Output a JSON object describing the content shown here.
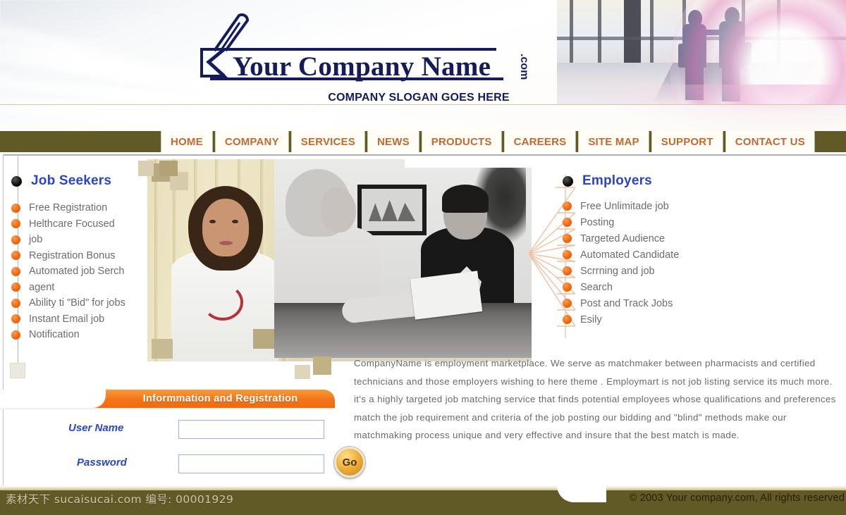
{
  "header": {
    "logo_title": "Your Company Name",
    "logo_dotcom": ".com",
    "slogan": "COMPANY SLOGAN GOES HERE",
    "banner_image_alt": "business-handshake-photo"
  },
  "nav": {
    "items": [
      {
        "label": "HOME"
      },
      {
        "label": "COMPANY"
      },
      {
        "label": "SERVICES"
      },
      {
        "label": "NEWS"
      },
      {
        "label": "PRODUCTS"
      },
      {
        "label": "CAREERS"
      },
      {
        "label": "SITE MAP"
      },
      {
        "label": "SUPPORT"
      },
      {
        "label": "CONTACT US"
      }
    ]
  },
  "job_seekers": {
    "title": "Job Seekers",
    "items": [
      "Free Registration",
      "Helthcare Focused",
      "job",
      "Registration  Bonus",
      "Automated job Serch",
      "agent",
      "Ability ti \"Bid\" for jobs",
      "Instant Email job",
      "Notification"
    ]
  },
  "employers": {
    "title": "Employers",
    "items": [
      "Free Unlimitade job",
      "Posting",
      "Targeted Audience",
      "Automated Candidate",
      "Scrrning and job",
      "Search",
      "Post and Track Jobs",
      "Esily"
    ]
  },
  "main": {
    "photo_alt": "doctor-and-office-interview-photo",
    "body_text": "CompanyName is employment marketplace. We serve as matchmaker between pharmacists and certified technicians and those employers wishing to here  theme . Employmart is not job listing service its much more. it's a highly targeted job matching service that finds potential employees whose qualifications and preferences match the job requirement and criteria of the job posting our bidding and \"blind\" methods make our matchmaking process unique and very effective and insure that the best match is made."
  },
  "login": {
    "panel_title": "Informmation and Registration",
    "user_label": "User Name",
    "user_value": "",
    "user_placeholder": "",
    "password_label": "Password",
    "password_value": "",
    "password_placeholder": "",
    "go_label": "Go"
  },
  "footer": {
    "watermark": "素材天下 sucaisucai.com  编号: 00001929",
    "copyright": "© 2003 Your company.com, All rights reserved"
  },
  "colors": {
    "olive": "#615926",
    "nav_text": "#c06a33",
    "heading_blue": "#2b46c4",
    "logo_navy": "#151c5c",
    "bullet_orange": "#f0670d",
    "panel_orange": "#f3761a",
    "body_grey": "#6a6a6a"
  }
}
